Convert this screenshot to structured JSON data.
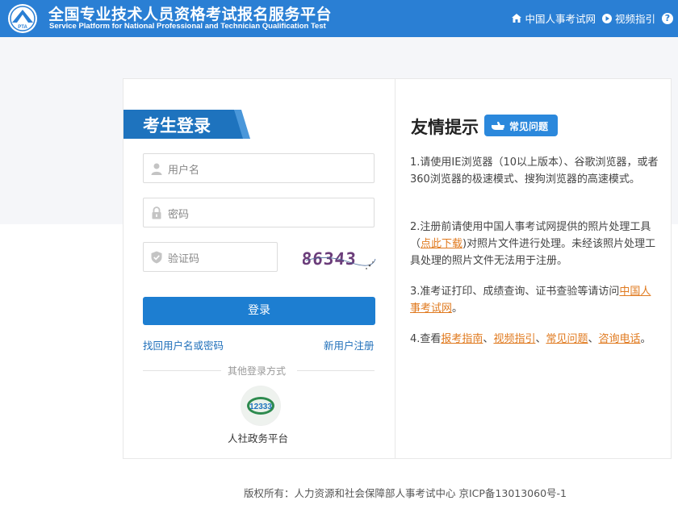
{
  "header": {
    "title_cn": "全国专业技术人员资格考试报名服务平台",
    "title_en": "Service Platform for National Professional and Technician Qualification Test",
    "logo_text": "PTA",
    "links": [
      {
        "icon": "home-icon",
        "label": "中国人事考试网"
      },
      {
        "icon": "play-icon",
        "label": "视频指引"
      }
    ],
    "help_label": "?"
  },
  "login": {
    "title": "考生登录",
    "username_placeholder": "用户名",
    "password_placeholder": "密码",
    "captcha_placeholder": "验证码",
    "captcha_text": "86343",
    "submit_label": "登录",
    "recover_link": "找回用户名或密码",
    "register_link": "新用户注册",
    "other_methods": "其他登录方式",
    "gov_platform_label": "人社政务平台",
    "gov_logo_text": "12333"
  },
  "tips": {
    "title": "友情提示",
    "faq_badge": "常见问题",
    "t1": "1.请使用IE浏览器（10以上版本）、谷歌浏览器，或者360浏览器的极速模式、搜狗浏览器的高速模式。",
    "t2_a": "2.注册前请使用中国人事考试网提供的照片处理工具（",
    "t2_link": "点此下载",
    "t2_b": ")对照片文件进行处理。未经该照片处理工具处理的照片文件无法用于注册。",
    "t3_a": "3.准考证打印、成绩查询、证书查验等请访问",
    "t3_link": "中国人事考试网",
    "t3_b": "。",
    "t4_a": "4.查看",
    "t4_link1": "报考指南",
    "t4_sep1": "、",
    "t4_link2": "视频指引",
    "t4_sep2": "、",
    "t4_link3": "常见问题",
    "t4_sep3": "、",
    "t4_link4": "咨询电话",
    "t4_b": "。"
  },
  "footer": {
    "copyright": "版权所有：人力资源和社会保障部人事考试中心 京ICP备13013060号-1"
  },
  "colors": {
    "header_bg": "#2a7fd4",
    "primary_button": "#1d7ed1",
    "link": "#1f6fba",
    "tip_link": "#e07a1f"
  }
}
